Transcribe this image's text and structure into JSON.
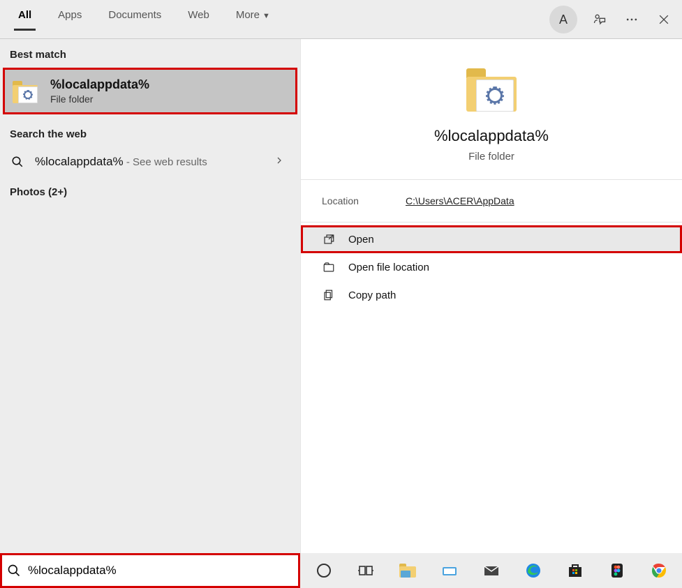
{
  "header": {
    "tabs": {
      "all": "All",
      "apps": "Apps",
      "documents": "Documents",
      "web": "Web",
      "more": "More"
    },
    "avatar_letter": "A"
  },
  "left": {
    "best_match_label": "Best match",
    "best_match": {
      "title": "%localappdata%",
      "subtitle": "File folder"
    },
    "search_web_label": "Search the web",
    "web_query": "%localappdata%",
    "web_suffix": " - See web results",
    "photos_label": "Photos (2+)"
  },
  "preview": {
    "title": "%localappdata%",
    "subtitle": "File folder",
    "location_label": "Location",
    "location_value": "C:\\Users\\ACER\\AppData",
    "actions": {
      "open": "Open",
      "open_location": "Open file location",
      "copy_path": "Copy path"
    }
  },
  "search_input": {
    "value": "%localappdata%"
  }
}
